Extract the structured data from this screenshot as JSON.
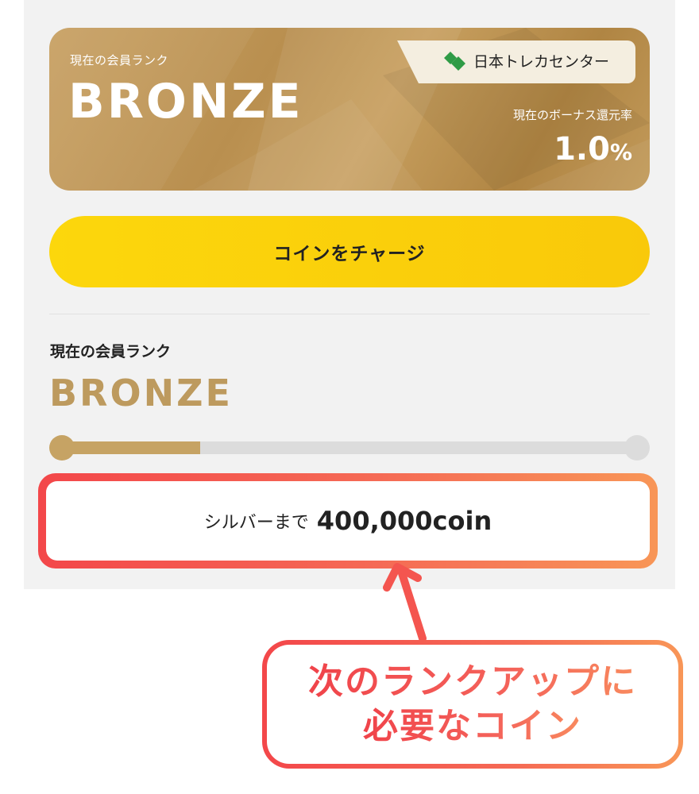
{
  "rank_card": {
    "label": "現在の会員ランク",
    "rank": "BRONZE",
    "brand_icon": "diamond-logo-icon",
    "brand_name": "日本トレカセンター",
    "bonus_label": "現在のボーナス還元率",
    "bonus_value": "1.0",
    "bonus_unit": "%"
  },
  "charge_button": {
    "label": "コインをチャージ"
  },
  "status": {
    "label": "現在の会員ランク",
    "rank": "BRONZE",
    "progress": 0.24
  },
  "next_rank": {
    "prefix": "シルバーまで",
    "amount": "400,000coin"
  },
  "callout": {
    "line1": "次のランクアップに",
    "line2": "必要なコイン"
  },
  "colors": {
    "gold": "#c6a364",
    "yellow": "#fcd70c",
    "accent_red": "#f3474a",
    "accent_orange": "#f89657"
  }
}
